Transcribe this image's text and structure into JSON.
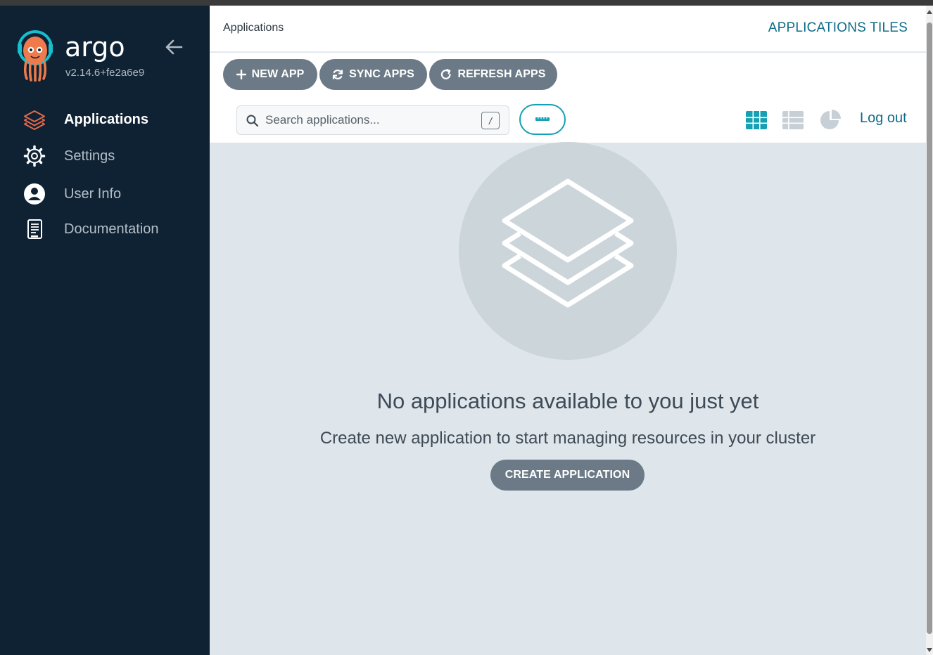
{
  "app": {
    "brand": "argo",
    "version": "v2.14.6+fe2a6e9"
  },
  "sidebar": {
    "items": [
      {
        "label": "Applications",
        "icon": "layers-icon",
        "active": true
      },
      {
        "label": "Settings",
        "icon": "gear-icon",
        "active": false
      },
      {
        "label": "User Info",
        "icon": "user-icon",
        "active": false
      },
      {
        "label": "Documentation",
        "icon": "book-icon",
        "active": false
      }
    ]
  },
  "header": {
    "breadcrumb": "Applications",
    "title": "APPLICATIONS TILES"
  },
  "toolbar": {
    "new_app": "NEW APP",
    "sync_apps": "SYNC APPS",
    "refresh_apps": "REFRESH APPS"
  },
  "search": {
    "placeholder": "Search applications...",
    "value": "",
    "shortcut": "/"
  },
  "views": {
    "tiles": "grid-view-icon",
    "list": "list-view-icon",
    "summary": "pie-chart-icon",
    "active": "tiles"
  },
  "logout": "Log out",
  "empty_state": {
    "title": "No applications available to you just yet",
    "subtitle": "Create new application to start managing resources in your cluster",
    "button": "CREATE APPLICATION"
  },
  "colors": {
    "sidebar_bg": "#0f2233",
    "accent": "#0e6b88",
    "teal": "#15a0b3",
    "button_bg": "#6b7a86",
    "content_bg": "#dee6eb",
    "active_nav_icon": "#e8684a"
  }
}
